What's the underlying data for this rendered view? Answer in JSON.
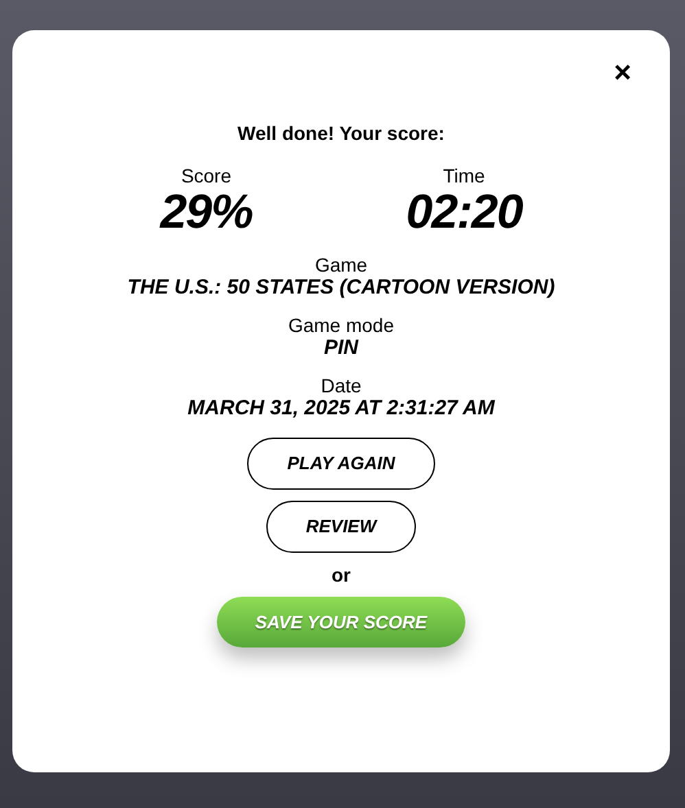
{
  "close_button": {
    "label": "×"
  },
  "heading": "Well done! Your score:",
  "stats": [
    {
      "label": "Score",
      "value": "29%"
    },
    {
      "label": "Time",
      "value": "02:20"
    }
  ],
  "details": [
    {
      "label": "Game",
      "value": "THE U.S.: 50 STATES (CARTOON VERSION)"
    },
    {
      "label": "Game mode",
      "value": "PIN"
    },
    {
      "label": "Date",
      "value": "MARCH 31, 2025 AT 2:31:27 AM"
    }
  ],
  "buttons": [
    {
      "label": "PLAY AGAIN",
      "kind": "outline"
    },
    {
      "label": "REVIEW",
      "kind": "outline"
    },
    {
      "label": "or",
      "kind": "separator"
    },
    {
      "label": "SAVE YOUR SCORE",
      "kind": "primary"
    }
  ]
}
